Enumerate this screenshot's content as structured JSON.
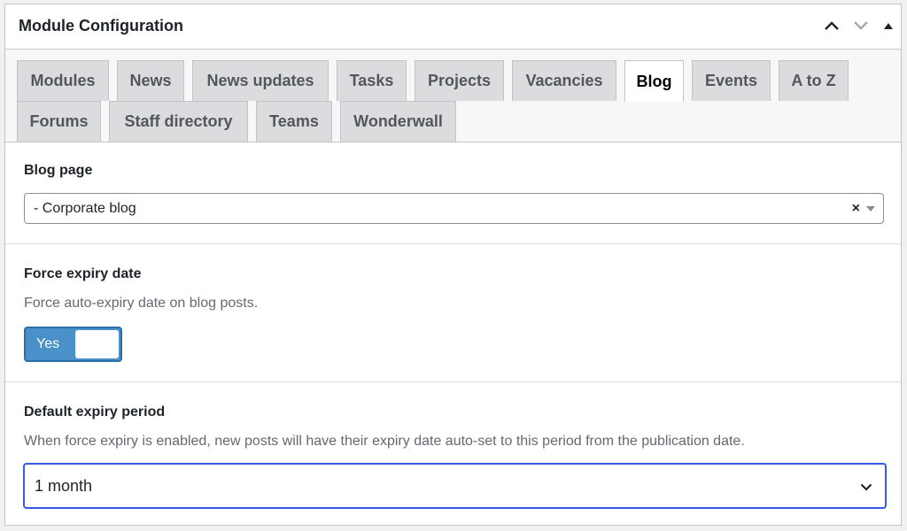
{
  "panel": {
    "title": "Module Configuration"
  },
  "tabs": [
    {
      "label": "Modules",
      "active": false
    },
    {
      "label": "News",
      "active": false
    },
    {
      "label": "News updates",
      "active": false
    },
    {
      "label": "Tasks",
      "active": false
    },
    {
      "label": "Projects",
      "active": false
    },
    {
      "label": "Vacancies",
      "active": false
    },
    {
      "label": "Blog",
      "active": true
    },
    {
      "label": "Events",
      "active": false
    },
    {
      "label": "A to Z",
      "active": false
    },
    {
      "label": "Forums",
      "active": false
    },
    {
      "label": "Staff directory",
      "active": false
    },
    {
      "label": "Teams",
      "active": false
    },
    {
      "label": "Wonderwall",
      "active": false
    }
  ],
  "blog_page": {
    "label": "Blog page",
    "value": "- Corporate blog",
    "clear_symbol": "×"
  },
  "force_expiry": {
    "label": "Force expiry date",
    "description": "Force auto-expiry date on blog posts.",
    "toggle_label": "Yes",
    "enabled": true
  },
  "default_expiry": {
    "label": "Default expiry period",
    "description": "When force expiry is enabled, new posts will have their expiry date auto-set to this period from the publication date.",
    "value": "1 month"
  },
  "colors": {
    "toggle_on": "#4a90c9",
    "focus_ring": "#3858e9"
  }
}
